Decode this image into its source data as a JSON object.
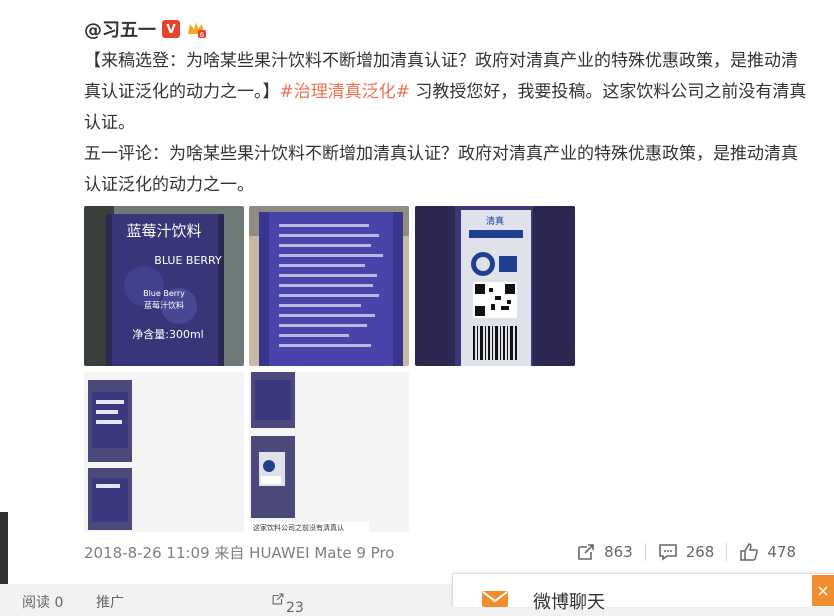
{
  "post": {
    "author": "@习五一",
    "verified_badge": "V",
    "paragraph1_prefix": "【来稿选登：为啥某些果汁饮料不断增加清真认证？政府对清真产业的特殊优惠政策，是推动清真认证泛化的动力之一。】",
    "hashtag": "#治理清真泛化#",
    "paragraph1_suffix": " 习教授您好，我要投稿。这家饮料公司之前没有清真认证。",
    "paragraph2": "五一评论：为啥某些果汁饮料不断增加清真认证？政府对清真产业的特殊优惠政策，是推动清真认证泛化的动力之一。",
    "timestamp": "2018-8-26 11:09 来自 HUAWEI Mate 9 Pro",
    "repost_count": "863",
    "comment_count": "268",
    "like_count": "478"
  },
  "images": {
    "img1_title": "蓝莓汁饮料",
    "img1_brand": "BLUE BERRY",
    "img1_brand_small": "Blue Berry",
    "img1_sub": "蓝莓汁饮料",
    "img1_volume": "净含量:300ml",
    "img3_label": "清真",
    "thumb_caption": "这家饮料公司之前没有清真认"
  },
  "bottom": {
    "read": "阅读 0",
    "promote": "推广",
    "repost": "23"
  },
  "chat": {
    "title": "微博聊天",
    "close": "×"
  },
  "colors": {
    "hashtag": "#eb7350",
    "verified": "#e8432d",
    "chat_accent": "#f08d2f"
  }
}
